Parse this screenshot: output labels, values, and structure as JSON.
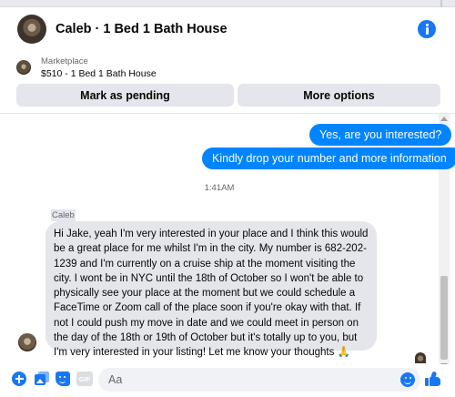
{
  "header": {
    "title": "Caleb · 1 Bed 1 Bath House"
  },
  "marketplace": {
    "label": "Marketplace",
    "listing": "$510 - 1 Bed 1 Bath House",
    "buttons": {
      "pending": "Mark as pending",
      "options": "More options"
    }
  },
  "messages": {
    "outgoing": [
      "Yes, are you interested?",
      "Kindly drop your number and more information"
    ],
    "timestamp": "1:41AM",
    "incoming": {
      "sender": "Caleb",
      "text": "Hi Jake, yeah I'm very interested in your place and I think this would be a great place for me whilst I'm in the city. My number is 682-202-1239 and I'm currently on a cruise ship at the moment visiting the city. I wont be in NYC until the 18th of October so I won't be able to physically see your place at the moment but we could schedule a FaceTime or Zoom call of the place soon if you're okay with that. If not I could push my move in date and we could meet in person on the day of the 18th or 19th of October but it's totally up to you, but I'm very interested in your listing!  Let me know your thoughts 🙏"
    }
  },
  "composer": {
    "placeholder": "Aa",
    "gif_label": "GIF"
  },
  "colors": {
    "accent": "#1877f2",
    "outgoing_bubble": "#0084ff",
    "incoming_bubble": "#e4e6eb"
  },
  "icons": [
    "info-icon",
    "plus-icon",
    "image-icon",
    "sticker-icon",
    "gif-icon",
    "emoji-icon",
    "like-icon"
  ]
}
